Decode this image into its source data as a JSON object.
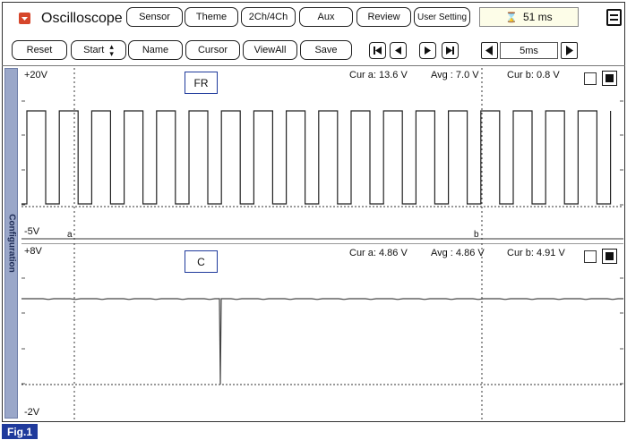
{
  "header": {
    "title": "Oscilloscope",
    "tabs": [
      "Sensor",
      "Theme",
      "2Ch/4Ch",
      "Aux",
      "Review",
      "User Setting"
    ],
    "timing": "51 ms"
  },
  "toolbar": {
    "reset": "Reset",
    "start": "Start",
    "name": "Name",
    "cursor": "Cursor",
    "view_all": "ViewAll",
    "save": "Save",
    "time_div": "5ms"
  },
  "sidebar": {
    "label": "Configuration"
  },
  "channels": [
    {
      "label": "FR",
      "ymax": "+20V",
      "ymin": "-5V",
      "cur_a": "Cur a: 13.6 V",
      "avg": "Avg  : 7.0 V",
      "cur_b": "Cur b: 0.8 V",
      "cursor_a": "a",
      "cursor_b": "b"
    },
    {
      "label": "C",
      "ymax": "+8V",
      "ymin": "-2V",
      "cur_a": "Cur a: 4.86 V",
      "avg": "Avg  : 4.86 V",
      "cur_b": "Cur b: 4.91 V"
    }
  ],
  "figure_label": "Fig.1",
  "colors": {
    "sidebar": "#9aa7c9",
    "header_btn_border": "#222222",
    "label_border": "#1f3a9c",
    "fig_tag": "#1f3a9c"
  }
}
